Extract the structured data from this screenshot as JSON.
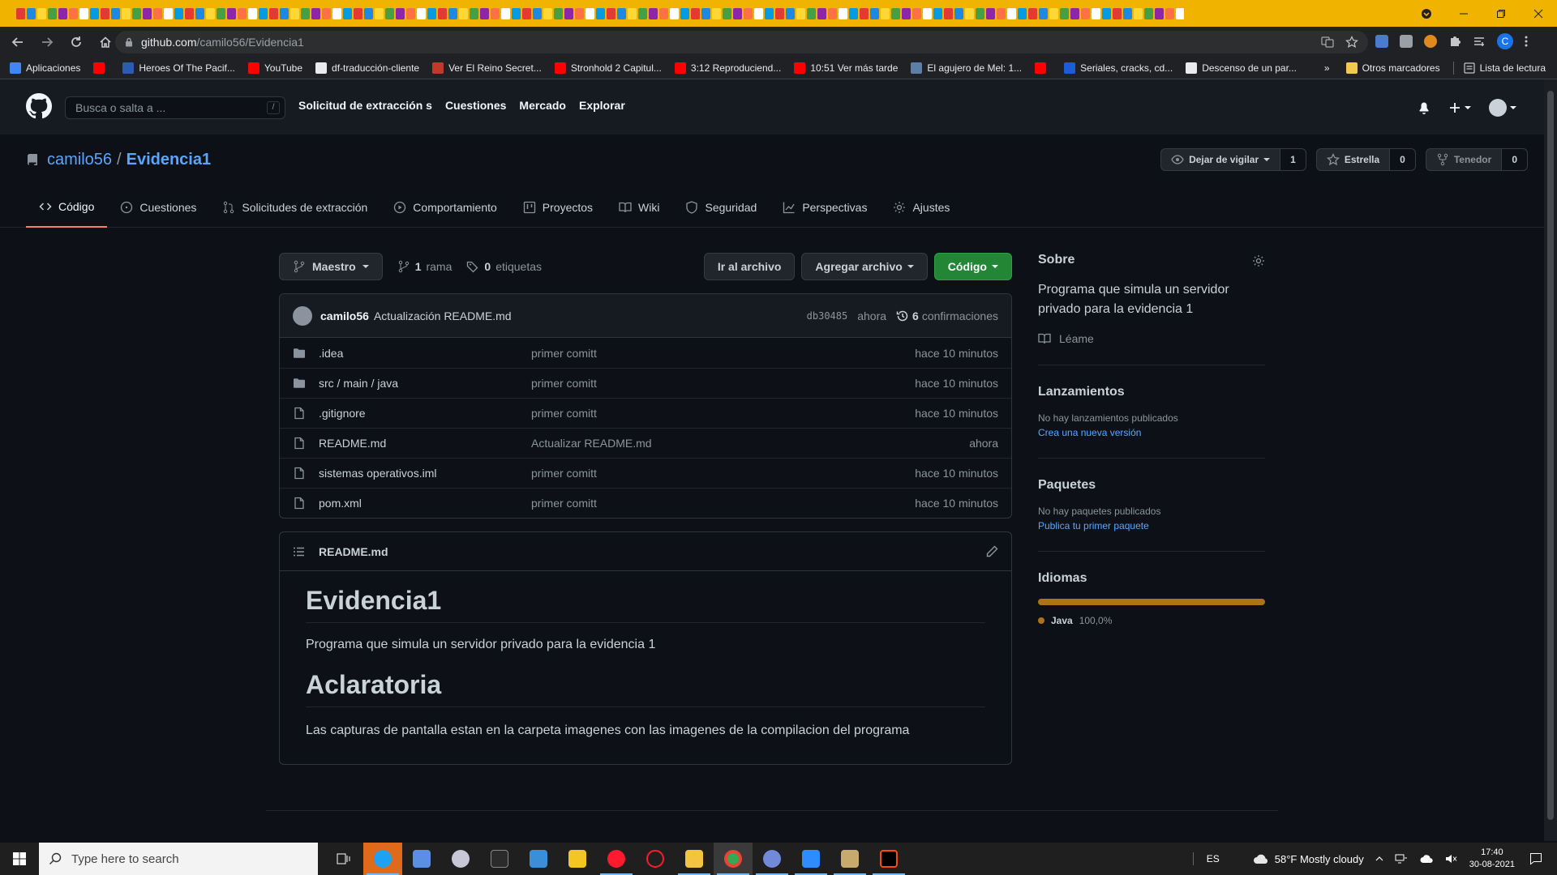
{
  "browser": {
    "active_tab_close": "×",
    "new_tab": "+",
    "url_host": "github.com",
    "url_path": "/camilo56/Evidencia1",
    "profile_initial": "C",
    "bookmarks": [
      {
        "label": "Aplicaciones",
        "color": "#4285f4"
      },
      {
        "label": "",
        "color": "#ff0000"
      },
      {
        "label": "Heroes Of The Pacif...",
        "color": "#2a5db0"
      },
      {
        "label": "YouTube",
        "color": "#ff0000"
      },
      {
        "label": "df-traducción-cliente",
        "color": "#e8eaed"
      },
      {
        "label": "Ver El Reino Secret...",
        "color": "#c0392b"
      },
      {
        "label": "Stronhold 2 Capitul...",
        "color": "#ff0000"
      },
      {
        "label": "3:12 Reproduciend...",
        "color": "#ff0000"
      },
      {
        "label": "10:51 Ver más tarde",
        "color": "#ff0000"
      },
      {
        "label": "El agujero de Mel: 1...",
        "color": "#5b7fa6"
      },
      {
        "label": "",
        "color": "#ff0000"
      },
      {
        "label": "Seriales, cracks, cd...",
        "color": "#1e5bd6"
      },
      {
        "label": "Descenso de un par...",
        "color": "#e8eaed"
      }
    ],
    "bookmarks_more": "»",
    "other_bookmarks": "Otros marcadores",
    "reading_list": "Lista de lectura"
  },
  "github": {
    "search_placeholder": "Busca o salta a ...",
    "search_key": "/",
    "nav": [
      "Solicitud de extracción s",
      "Cuestiones",
      "Mercado",
      "Explorar"
    ],
    "owner": "camilo56",
    "separator": "/",
    "repo": "Evidencia1",
    "watch_label": "Dejar de vigilar",
    "watch_count": "1",
    "star_label": "Estrella",
    "star_count": "0",
    "fork_label": "Tenedor",
    "fork_count": "0",
    "tabs": [
      {
        "label": "Código"
      },
      {
        "label": "Cuestiones"
      },
      {
        "label": "Solicitudes de extracción"
      },
      {
        "label": "Comportamiento"
      },
      {
        "label": "Proyectos"
      },
      {
        "label": "Wiki"
      },
      {
        "label": "Seguridad"
      },
      {
        "label": "Perspectivas"
      },
      {
        "label": "Ajustes"
      }
    ]
  },
  "files": {
    "branch": "Maestro",
    "branch_count": "1",
    "branch_word": "rama",
    "tag_count": "0",
    "tag_word": "etiquetas",
    "goto_file": "Ir al archivo",
    "add_file": "Agregar archivo",
    "code_button": "Código",
    "commit_user": "camilo56",
    "commit_message": "Actualización README.md",
    "commit_sha": "db30485",
    "commit_time": "ahora",
    "commit_count": "6",
    "commit_word": "confirmaciones",
    "rows": [
      {
        "type": "dir",
        "name": ".idea",
        "message": "primer comitt",
        "age": "hace 10 minutos"
      },
      {
        "type": "dir",
        "name": "src / main / java",
        "message": "primer comitt",
        "age": "hace 10 minutos"
      },
      {
        "type": "file",
        "name": ".gitignore",
        "message": "primer comitt",
        "age": "hace 10 minutos"
      },
      {
        "type": "file",
        "name": "README.md",
        "message": "Actualizar README.md",
        "age": "ahora"
      },
      {
        "type": "file",
        "name": "sistemas operativos.iml",
        "message": "primer comitt",
        "age": "hace 10 minutos"
      },
      {
        "type": "file",
        "name": "pom.xml",
        "message": "primer comitt",
        "age": "hace 10 minutos"
      }
    ]
  },
  "readme": {
    "filename": "README.md",
    "h1": "Evidencia1",
    "p1": "Programa que simula un servidor privado para la evidencia 1",
    "h2": "Aclaratoria",
    "p2": "Las capturas de pantalla estan en la carpeta imagenes con las imagenes de la compilacion del programa"
  },
  "sidebar": {
    "about_title": "Sobre",
    "about_desc": "Programa que simula un servidor privado para la evidencia 1",
    "readme_link": "Léame",
    "releases_title": "Lanzamientos",
    "releases_none": "No hay lanzamientos publicados",
    "releases_create": "Crea una nueva versión",
    "packages_title": "Paquetes",
    "packages_none": "No hay paquetes publicados",
    "packages_publish": "Publica tu primer paquete",
    "languages_title": "Idiomas",
    "language_name": "Java",
    "language_pct": "100,0%",
    "language_color": "#b07219",
    "language_share": 1.0
  },
  "taskbar": {
    "search_placeholder": "Type here to search",
    "lang": "ES",
    "weather": "58°F  Mostly cloudy",
    "time": "17:40",
    "date": "30-08-2021"
  }
}
